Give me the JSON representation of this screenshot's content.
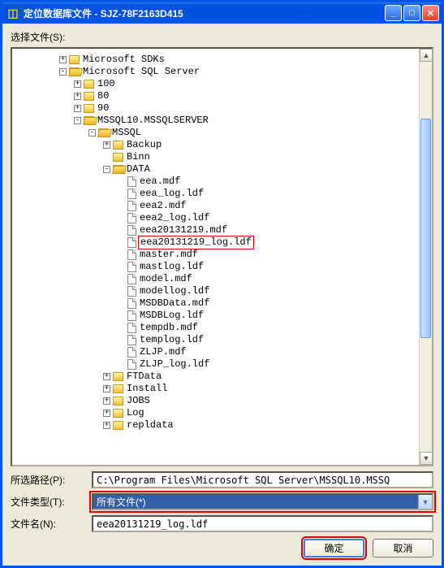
{
  "titlebar": {
    "icon": "database-icon",
    "title": "定位数据库文件 - SJZ-78F2163D415"
  },
  "labels": {
    "select_file": "选择文件(S):",
    "selected_path": "所选路径(P):",
    "file_type": "文件类型(T):",
    "file_name": "文件名(N):"
  },
  "tree": [
    {
      "indent": 3,
      "expand": "+",
      "icon": "folder",
      "label": "Microsoft SDKs"
    },
    {
      "indent": 3,
      "expand": "-",
      "icon": "folder-open",
      "label": "Microsoft SQL Server"
    },
    {
      "indent": 4,
      "expand": "+",
      "icon": "folder",
      "label": "100"
    },
    {
      "indent": 4,
      "expand": "+",
      "icon": "folder",
      "label": "80"
    },
    {
      "indent": 4,
      "expand": "+",
      "icon": "folder",
      "label": "90"
    },
    {
      "indent": 4,
      "expand": "-",
      "icon": "folder-open",
      "label": "MSSQL10.MSSQLSERVER"
    },
    {
      "indent": 5,
      "expand": "-",
      "icon": "folder-open",
      "label": "MSSQL"
    },
    {
      "indent": 6,
      "expand": "+",
      "icon": "folder",
      "label": "Backup"
    },
    {
      "indent": 6,
      "expand": "",
      "icon": "folder",
      "label": "Binn"
    },
    {
      "indent": 6,
      "expand": "-",
      "icon": "folder-open",
      "label": "DATA"
    },
    {
      "indent": 7,
      "expand": "",
      "icon": "file",
      "label": "eea.mdf"
    },
    {
      "indent": 7,
      "expand": "",
      "icon": "file",
      "label": "eea_log.ldf"
    },
    {
      "indent": 7,
      "expand": "",
      "icon": "file",
      "label": "eea2.mdf"
    },
    {
      "indent": 7,
      "expand": "",
      "icon": "file",
      "label": "eea2_log.ldf"
    },
    {
      "indent": 7,
      "expand": "",
      "icon": "file",
      "label": "eea20131219.mdf"
    },
    {
      "indent": 7,
      "expand": "",
      "icon": "file",
      "label": "eea20131219_log.ldf",
      "highlight": true
    },
    {
      "indent": 7,
      "expand": "",
      "icon": "file",
      "label": "master.mdf"
    },
    {
      "indent": 7,
      "expand": "",
      "icon": "file",
      "label": "mastlog.ldf"
    },
    {
      "indent": 7,
      "expand": "",
      "icon": "file",
      "label": "model.mdf"
    },
    {
      "indent": 7,
      "expand": "",
      "icon": "file",
      "label": "modellog.ldf"
    },
    {
      "indent": 7,
      "expand": "",
      "icon": "file",
      "label": "MSDBData.mdf"
    },
    {
      "indent": 7,
      "expand": "",
      "icon": "file",
      "label": "MSDBLog.ldf"
    },
    {
      "indent": 7,
      "expand": "",
      "icon": "file",
      "label": "tempdb.mdf"
    },
    {
      "indent": 7,
      "expand": "",
      "icon": "file",
      "label": "templog.ldf"
    },
    {
      "indent": 7,
      "expand": "",
      "icon": "file",
      "label": "ZLJP.mdf"
    },
    {
      "indent": 7,
      "expand": "",
      "icon": "file",
      "label": "ZLJP_log.ldf"
    },
    {
      "indent": 6,
      "expand": "+",
      "icon": "folder",
      "label": "FTData"
    },
    {
      "indent": 6,
      "expand": "+",
      "icon": "folder",
      "label": "Install"
    },
    {
      "indent": 6,
      "expand": "+",
      "icon": "folder",
      "label": "JOBS"
    },
    {
      "indent": 6,
      "expand": "+",
      "icon": "folder",
      "label": "Log"
    },
    {
      "indent": 6,
      "expand": "+",
      "icon": "folder",
      "label": "repldata"
    }
  ],
  "values": {
    "selected_path": "C:\\Program Files\\Microsoft SQL Server\\MSSQL10.MSSQ",
    "file_type": "所有文件(*)",
    "file_name": "eea20131219_log.ldf"
  },
  "buttons": {
    "ok": "确定",
    "cancel": "取消"
  }
}
